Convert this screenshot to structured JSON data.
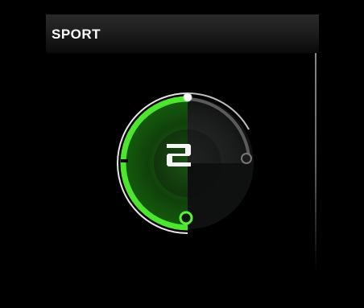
{
  "mode": {
    "title": "SPORT"
  },
  "gear": {
    "value": "2",
    "level_fraction": 0.5
  },
  "colors": {
    "accent": "#4ee52e",
    "ring": "#d8d8d8",
    "indicator_dark": "#444444",
    "background": "#000000"
  },
  "icons": {
    "top_knob": "circle-knob-white",
    "right_knob": "circle-knob-gray",
    "bottom_knob": "circle-knob-green"
  }
}
